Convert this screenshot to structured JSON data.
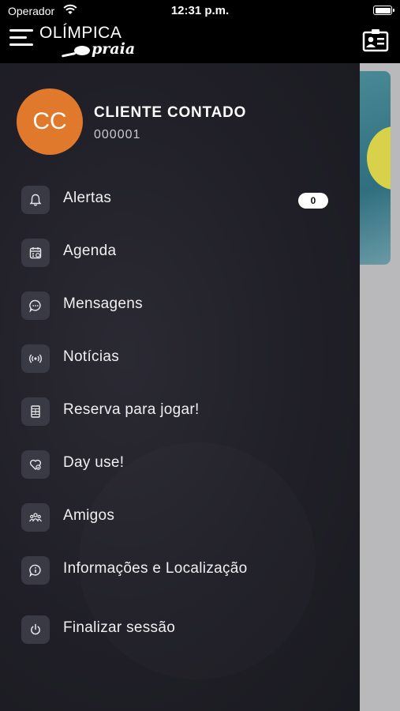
{
  "status_bar": {
    "carrier": "Operador",
    "time": "12:31 p.m."
  },
  "header": {
    "logo_top": "OLÍMPICA",
    "logo_bottom": "praia"
  },
  "user": {
    "initials": "CC",
    "name": "CLIENTE CONTADO",
    "id": "000001"
  },
  "menu": [
    {
      "label": "Alertas",
      "icon": "bell-icon",
      "badge": "0"
    },
    {
      "label": "Agenda",
      "icon": "calendar-icon"
    },
    {
      "label": "Mensagens",
      "icon": "chat-bubble-icon"
    },
    {
      "label": "Notícias",
      "icon": "broadcast-icon"
    },
    {
      "label": "Reserva para jogar!",
      "icon": "court-icon"
    },
    {
      "label": "Day use!",
      "icon": "heart-icon"
    },
    {
      "label": "Amigos",
      "icon": "people-icon"
    },
    {
      "label": "Informações e Localização",
      "icon": "info-bubble-icon"
    },
    {
      "label": "Finalizar sessão",
      "icon": "power-icon"
    }
  ],
  "colors": {
    "avatar": "#e0792c",
    "drawer": "#201f27",
    "icon_tile": "#3a3a44"
  }
}
